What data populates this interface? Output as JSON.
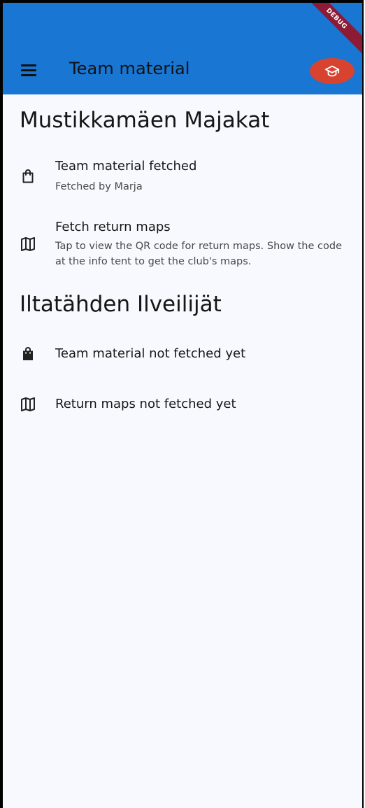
{
  "appbar": {
    "title": "Team material",
    "menu_icon": "hamburger-menu-icon",
    "avatar_icon": "graduation-cap-icon",
    "debug_banner": "DEBUG"
  },
  "teams": [
    {
      "name": "Mustikkamäen Majakat",
      "items": [
        {
          "icon": "shopping-bag-outline-icon",
          "title": "Team material fetched",
          "subtitle": "Fetched by Marja"
        },
        {
          "icon": "map-icon",
          "title": "Fetch return maps",
          "subtitle": "Tap to view the QR code for return maps. Show the code at the info tent to get the club's maps."
        }
      ]
    },
    {
      "name": "Iltatähden Ilveilijät",
      "items": [
        {
          "icon": "shopping-bag-filled-icon",
          "title": "Team material not fetched yet"
        },
        {
          "icon": "map-icon",
          "title": "Return maps not fetched yet"
        }
      ]
    }
  ],
  "colors": {
    "appbar": "#1976d2",
    "avatar": "#d8432f",
    "background": "#f8f8ff",
    "debug_ribbon": "#8e1b36"
  }
}
